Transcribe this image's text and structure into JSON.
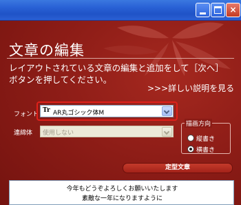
{
  "window": {
    "minimize_label": "",
    "maximize_label": "",
    "close_label": "×"
  },
  "page": {
    "title": "文章の編集",
    "description_line1": "レイアウトされている文章の編集と追加をして［次へ］",
    "description_line2": "ボタンを押してください。",
    "details_link": ">>>詳しい説明を見る"
  },
  "font": {
    "label": "フォント",
    "icon_text": "Tr",
    "value": "AR丸ゴシック体M"
  },
  "shape": {
    "label": "連綿体",
    "value": "使用しない"
  },
  "direction": {
    "label": "描画方向",
    "vertical_label": "縦書き",
    "horizontal_label": "横書き",
    "selected": "横書き"
  },
  "template_button": "定型文章",
  "message": {
    "line1": "今年もどうぞよろしくお願いいたします",
    "line2": "素敵な一年になりますように"
  },
  "colors": {
    "accent_red": "#e0201a",
    "background": "#8e1d17"
  }
}
